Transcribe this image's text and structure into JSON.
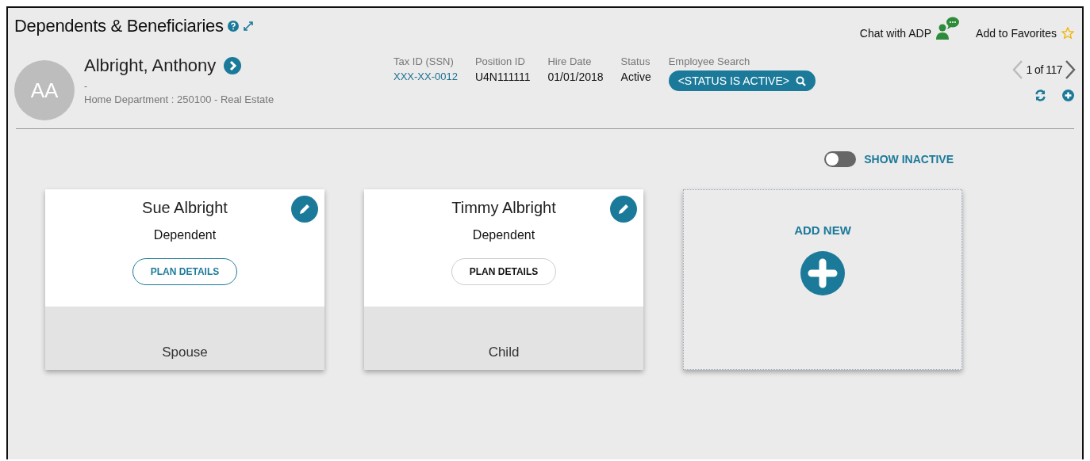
{
  "page": {
    "title": "Dependents & Beneficiaries",
    "chat_link": "Chat with ADP",
    "favorites_link": "Add to Favorites"
  },
  "employee": {
    "initials": "AA",
    "name": "Albright, Anthony",
    "subtitle": "-",
    "department": "Home Department : 250100 - Real Estate",
    "fields": [
      {
        "label": "Tax ID (SSN)",
        "value": "XXX-XX-0012",
        "kind": "link"
      },
      {
        "label": "Position ID",
        "value": "U4N111111",
        "kind": "text"
      },
      {
        "label": "Hire Date",
        "value": "01/01/2018",
        "kind": "text"
      },
      {
        "label": "Status",
        "value": "Active",
        "kind": "text"
      }
    ],
    "search": {
      "label": "Employee Search",
      "value": "<STATUS IS ACTIVE>"
    },
    "pager": "1 of 117"
  },
  "show_inactive": {
    "label": "SHOW INACTIVE",
    "on": false
  },
  "cards": [
    {
      "name": "Sue Albright",
      "type": "Dependent",
      "button": {
        "label": "PLAN DETAILS",
        "selected": true
      },
      "relationship": "Spouse"
    },
    {
      "name": "Timmy Albright",
      "type": "Dependent",
      "button": {
        "label": "PLAN DETAILS",
        "selected": false
      },
      "relationship": "Child"
    }
  ],
  "add_new": {
    "label": "ADD NEW"
  }
}
